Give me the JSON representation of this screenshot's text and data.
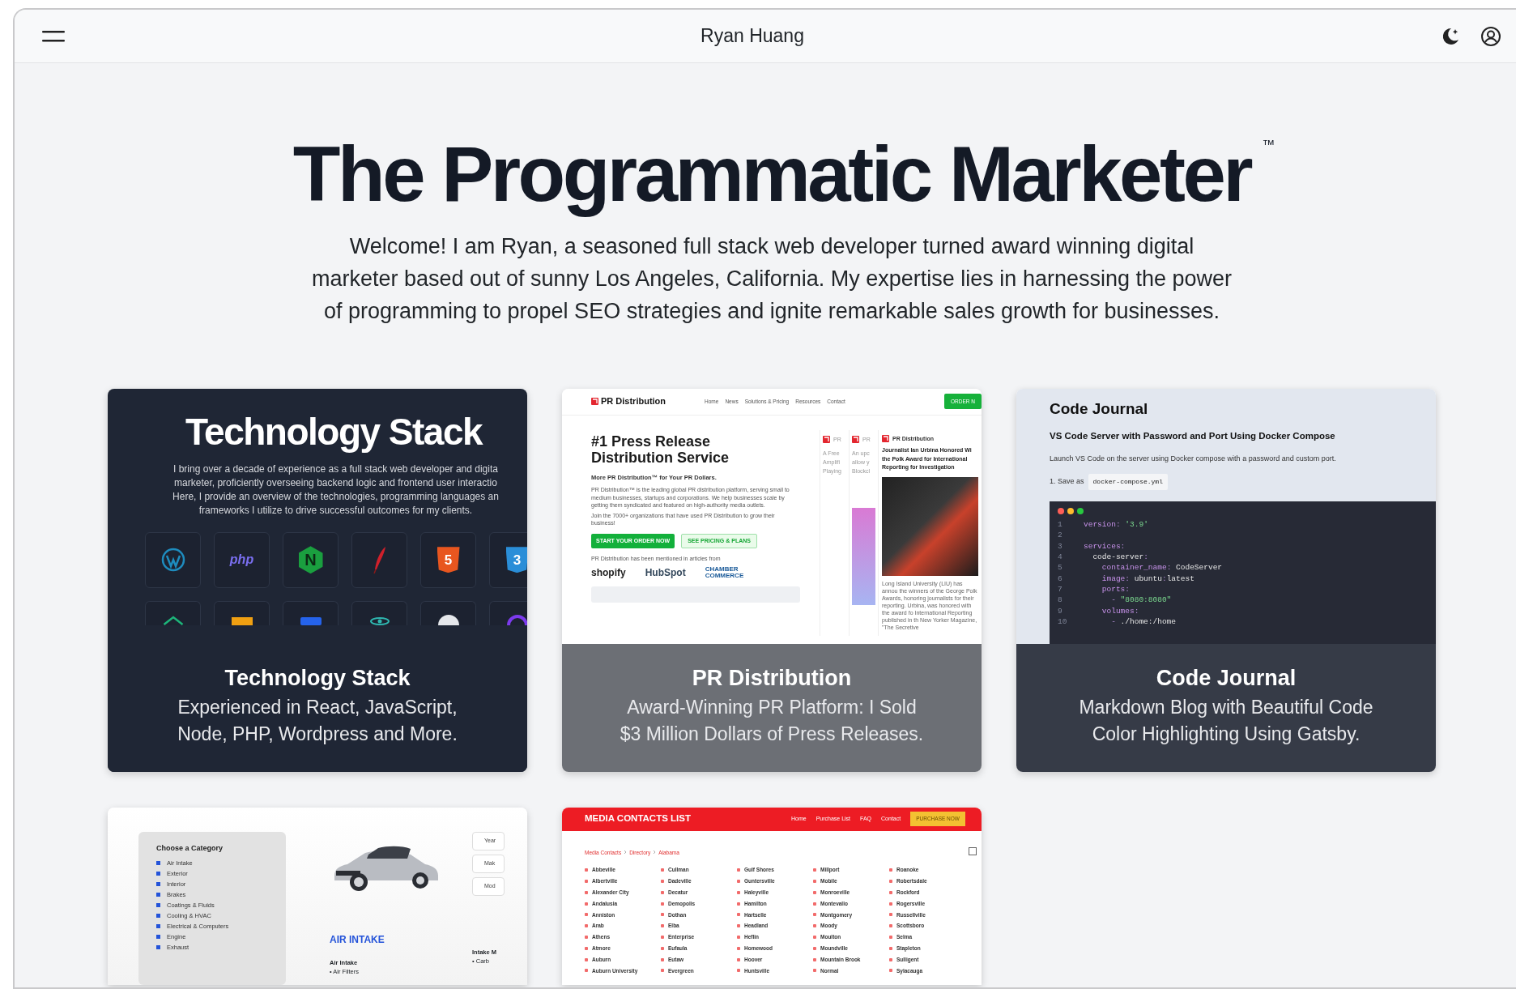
{
  "navbar": {
    "brand": "Ryan Huang"
  },
  "hero": {
    "title": "The Programmatic Marketer",
    "trademark": "™",
    "intro": "Welcome! I am Ryan, a seasoned full stack web developer turned award winning digital marketer based out of sunny Los Angeles, California. My expertise lies in harnessing the power of programming to propel SEO strategies and ignite remarkable sales growth for businesses."
  },
  "cards": [
    {
      "kind": "tech",
      "title": "Technology Stack",
      "subtitle": "Experienced in React, JavaScript, Node, PHP, Wordpress and More.",
      "preview": {
        "heading": "Technology Stack",
        "lines": [
          "I bring over a decade of experience as a full stack web developer and digita",
          "marketer, proficiently overseeing backend logic and frontend user interactio",
          "Here, I provide an overview of the technologies, programming languages an",
          "frameworks I utilize to drive successful outcomes for my clients."
        ],
        "icons": [
          {
            "kind": "wordpress"
          },
          {
            "kind": "php",
            "label": "php"
          },
          {
            "kind": "nginx",
            "label": "N"
          },
          {
            "kind": "feather"
          },
          {
            "kind": "html5",
            "label": "5"
          },
          {
            "kind": "css3",
            "label": "3"
          },
          {
            "kind": "house"
          },
          {
            "kind": "folder"
          },
          {
            "kind": "box"
          },
          {
            "kind": "atom"
          },
          {
            "kind": "circle"
          },
          {
            "kind": "ring"
          }
        ]
      }
    },
    {
      "kind": "pr",
      "title": "PR Distribution",
      "subtitle": "Award-Winning PR Platform: I Sold $3 Million Dollars of Press Releases.",
      "preview": {
        "logo": "PR Distribution",
        "nav": [
          "Home",
          "News",
          "Solutions & Pricing",
          "Resources",
          "Contact"
        ],
        "order_button": "ORDER N",
        "heading": "#1 Press Release Distribution Service",
        "subheading": "More PR Distribution™ for Your PR Dollars.",
        "paragraphs": [
          "PR Distribution™ is the leading global PR distribution platform, serving small to medium businesses, startups and corporations. We help businesses scale by getting them syndicated and featured on high-authority media outlets.",
          "Join the 7000+ organizations that have used PR Distribution to grow their business!"
        ],
        "primary_button": "START YOUR ORDER NOW",
        "secondary_button": "SEE PRICING & PLANS",
        "mentions": "PR Distribution has been mentioned in articles from",
        "partners": [
          "shopify",
          "HubSpot",
          "CHAMBER COMMERCE"
        ],
        "articles": [
          {
            "logo": "PR",
            "lines": [
              "A Free",
              "Amplifi",
              "Playing"
            ]
          },
          {
            "logo": "PR",
            "lines": [
              "An upc",
              "allow y",
              "Blockcl"
            ]
          }
        ],
        "feature": {
          "logo": "PR Distribution",
          "headline": "Journalist Ian Urbina Honored Wi the Polk Award for International Reporting for Investigation",
          "body": "Long Island University (LIU) has annou the winners of the George Polk Awards, honoring journalists for their reporting. Urbina, was honored with the award fo International Reporting published in th New Yorker Magazine, \"The Secretive"
        }
      }
    },
    {
      "kind": "code",
      "title": "Code Journal",
      "subtitle": "Markdown Blog with Beautiful Code Color Highlighting Using Gatsby.",
      "preview": {
        "heading": "Code Journal",
        "post_title": "VS Code Server with Password and Port Using Docker Compose",
        "description": "Launch VS Code on the server using Docker compose with a password and custom port.",
        "step": "1. Save as",
        "filename": "docker-compose.yml",
        "code": [
          {
            "num": "1",
            "tokens": [
              {
                "kind": "key",
                "text": "version"
              },
              {
                "kind": "punct",
                "text": ": "
              },
              {
                "kind": "str",
                "text": "'3.9'"
              }
            ]
          },
          {
            "num": "2"
          },
          {
            "num": "3",
            "tokens": [
              {
                "kind": "key",
                "text": "services"
              },
              {
                "kind": "punct",
                "text": ":"
              }
            ]
          },
          {
            "num": "4",
            "tokens": [
              {
                "kind": "plain",
                "text": "  code-server"
              },
              {
                "kind": "punct",
                "text": ":"
              }
            ]
          },
          {
            "num": "5",
            "tokens": [
              {
                "kind": "key",
                "text": "    container_name"
              },
              {
                "kind": "punct",
                "text": ": "
              },
              {
                "kind": "plain",
                "text": "CodeServer"
              }
            ]
          },
          {
            "num": "6",
            "tokens": [
              {
                "kind": "key",
                "text": "    image"
              },
              {
                "kind": "punct",
                "text": ": "
              },
              {
                "kind": "plain",
                "text": "ubuntu"
              },
              {
                "kind": "punct",
                "text": ":"
              },
              {
                "kind": "plain",
                "text": "latest"
              }
            ]
          },
          {
            "num": "7",
            "tokens": [
              {
                "kind": "key",
                "text": "    ports"
              },
              {
                "kind": "punct",
                "text": ":"
              }
            ]
          },
          {
            "num": "8",
            "tokens": [
              {
                "kind": "punct",
                "text": "      - "
              },
              {
                "kind": "str",
                "text": "\"8080:8080\""
              }
            ]
          },
          {
            "num": "9",
            "tokens": [
              {
                "kind": "key",
                "text": "    volumes"
              },
              {
                "kind": "punct",
                "text": ":"
              }
            ]
          },
          {
            "num": "10",
            "tokens": [
              {
                "kind": "punct",
                "text": "      - "
              },
              {
                "kind": "plain",
                "text": "./home:/home"
              }
            ]
          }
        ]
      }
    },
    {
      "kind": "parts",
      "preview": {
        "category_title": "Choose a Category",
        "categories": [
          "Air Intake",
          "Exterior",
          "Interior",
          "Brakes",
          "Coatings & Fluids",
          "Cooling & HVAC",
          "Electrical & Computers",
          "Engine",
          "Exhaust"
        ],
        "selects": [
          "Year",
          "Mak",
          "Mod"
        ],
        "section_title": "AIR INTAKE",
        "groups": [
          {
            "title": "Air Intake",
            "items": [
              "• Air Filters"
            ]
          },
          {
            "title": "Intake M",
            "items": [
              "• Carb"
            ]
          }
        ]
      }
    },
    {
      "kind": "media",
      "preview": {
        "logo": "MEDIA CONTACTS LIST",
        "nav": [
          "Home",
          "Purchase List",
          "FAQ",
          "Contact"
        ],
        "cta": "PURCHASE NOW",
        "breadcrumb": [
          "Media Contacts",
          "Directory",
          "Alabama"
        ],
        "cities": [
          "Abbeville",
          "Albertville",
          "Alexander City",
          "Andalusia",
          "Anniston",
          "Arab",
          "Athens",
          "Atmore",
          "Auburn",
          "Auburn University",
          "Cullman",
          "Dadeville",
          "Decatur",
          "Demopolis",
          "Dothan",
          "Elba",
          "Enterprise",
          "Eufaula",
          "Eutaw",
          "Evergreen",
          "Gulf Shores",
          "Guntersville",
          "Haleyville",
          "Hamilton",
          "Hartselle",
          "Headland",
          "Heflin",
          "Homewood",
          "Hoover",
          "Huntsville",
          "Millport",
          "Mobile",
          "Monroeville",
          "Montevallo",
          "Montgomery",
          "Moody",
          "Moulton",
          "Moundville",
          "Mountain Brook",
          "Normal",
          "Roanoke",
          "Robertsdale",
          "Rockford",
          "Rogersville",
          "Russellville",
          "Scottsboro",
          "Selma",
          "Stapleton",
          "Sulligent",
          "Sylacauga"
        ]
      }
    }
  ]
}
